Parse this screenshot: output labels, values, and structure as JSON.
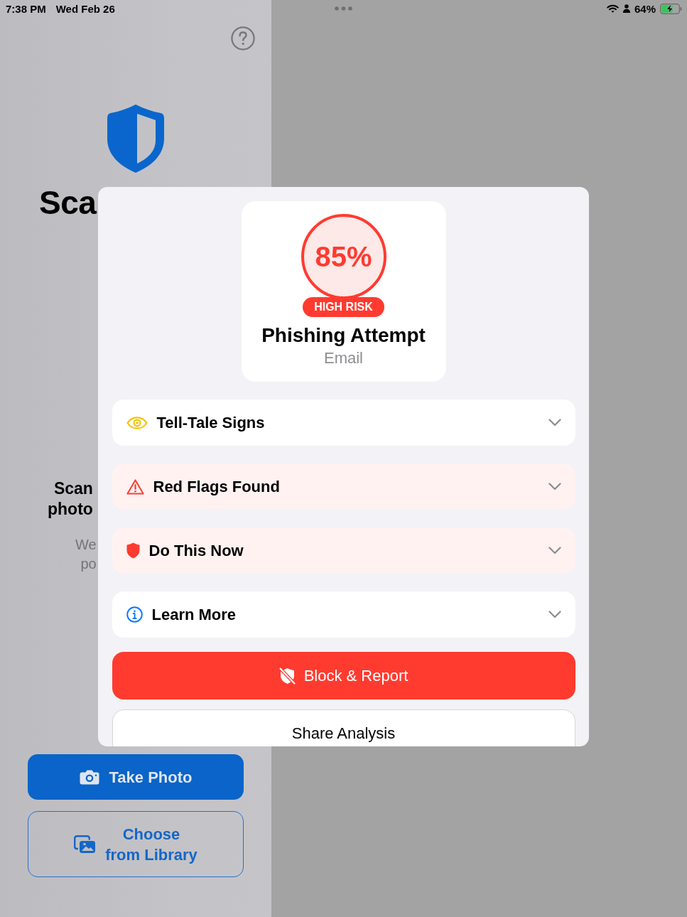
{
  "status_bar": {
    "time": "7:38 PM",
    "date": "Wed Feb 26",
    "battery": "64%"
  },
  "scanner": {
    "title": "Sca",
    "subtitle": [
      "Scan",
      "photo"
    ],
    "description": [
      "We",
      "po"
    ],
    "buttons": [
      {
        "kind": "primary",
        "lines": [
          "Take Photo"
        ]
      },
      {
        "kind": "secondary",
        "lines": [
          "Choose",
          "from Library"
        ]
      }
    ]
  },
  "result_sheet": {
    "score": "85%",
    "risk": "HIGH RISK",
    "title": "Phishing Attempt",
    "source": "Email",
    "sections": [
      {
        "kind": "signs",
        "title": "Tell-Tale Signs",
        "expanded": false
      },
      {
        "kind": "red_flags",
        "title": "Red Flags Found",
        "expanded": false
      },
      {
        "kind": "actions",
        "title": "Do This Now",
        "expanded": false
      },
      {
        "kind": "info",
        "title": "Learn More",
        "expanded": false
      }
    ],
    "actions": [
      {
        "kind": "destructive",
        "label": "Block & Report"
      },
      {
        "kind": "secondary",
        "label": "Share Analysis"
      }
    ]
  }
}
